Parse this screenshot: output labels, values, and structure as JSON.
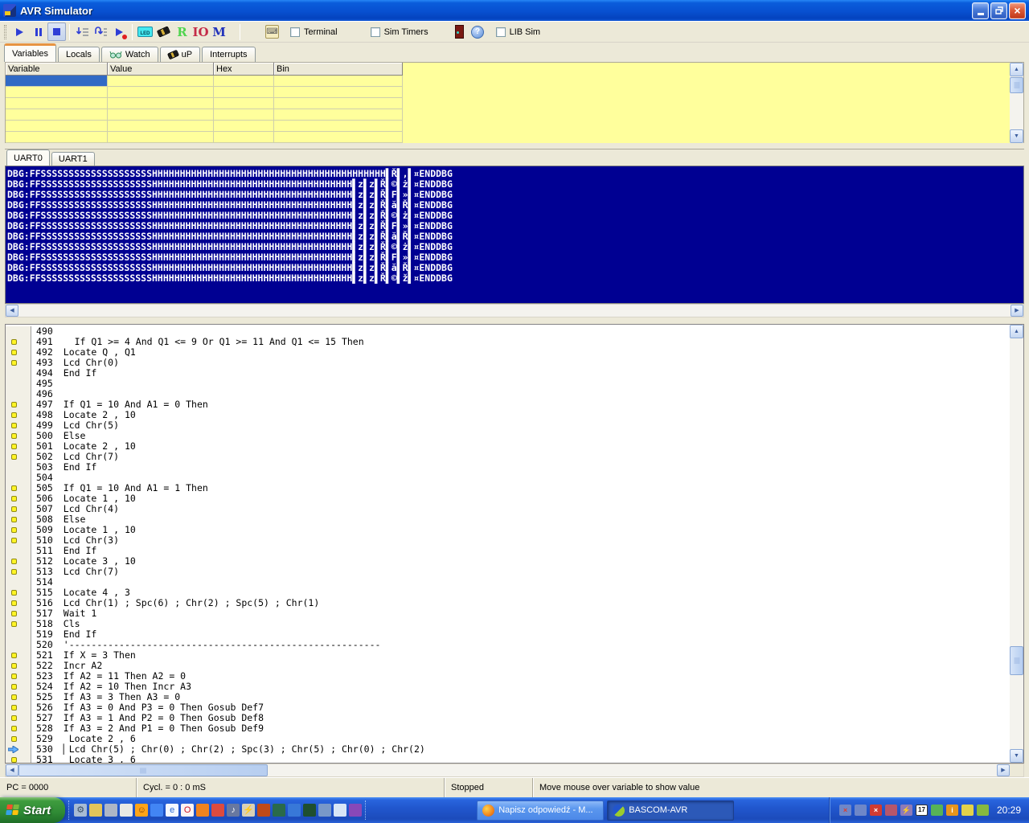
{
  "window": {
    "title": "AVR Simulator"
  },
  "toolbar": {
    "led_label": "LED",
    "r_label": "R",
    "io_label": "IO",
    "m_label": "M",
    "terminal_label": "Terminal",
    "sim_timers_label": "Sim Timers",
    "lib_sim_label": "LIB Sim",
    "accent_blue": "#2E3ED6"
  },
  "tabs": {
    "items": [
      "Variables",
      "Locals",
      "Watch",
      "uP",
      "Interrupts"
    ],
    "active": "Variables"
  },
  "variables_table": {
    "columns": [
      "Variable",
      "Value",
      "Hex",
      "Bin"
    ],
    "row_count": 6,
    "selected_cell": {
      "row": 0,
      "col": 0
    },
    "grid_bg": "#FFFF9C",
    "selection_color": "#316AC5"
  },
  "uart": {
    "tabs": [
      "UART0",
      "UART1"
    ],
    "active": "UART0",
    "terminal_bg": "#000092",
    "lines": [
      "DBG:FFSSSSSSSSSSSSSSSSSSSSHHHHHHHHHHHHHHHHHHHHHHHHHHHHHHHHHHHHHHHHHH▌Ř▌,▌¤ENDDBG",
      "DBG:FFSSSSSSSSSSSSSSSSSSSSHHHHHHHHHHHHHHHHHHHHHHHHHHHHHHHHHHHH▌z▌z▌Ř▌©▌ż▌¤ENDDBG",
      "DBG:FFSSSSSSSSSSSSSSSSSSSSHHHHHHHHHHHHHHHHHHHHHHHHHHHHHHHHHHHH▌z▌z▌Ř▌F▌»▌¤ENDDBG",
      "DBG:FFSSSSSSSSSSSSSSSSSSSSHHHHHHHHHHHHHHHHHHHHHHHHHHHHHHHHHHHH▌z▌z▌Ř▌ă▌Ř▌¤ENDDBG",
      "DBG:FFSSSSSSSSSSSSSSSSSSSSHHHHHHHHHHHHHHHHHHHHHHHHHHHHHHHHHHHH▌z▌z▌Ř▌©▌ż▌¤ENDDBG",
      "DBG:FFSSSSSSSSSSSSSSSSSSSSHHHHHHHHHHHHHHHHHHHHHHHHHHHHHHHHHHHH▌z▌z▌Ř▌F▌»▌¤ENDDBG",
      "DBG:FFSSSSSSSSSSSSSSSSSSSSHHHHHHHHHHHHHHHHHHHHHHHHHHHHHHHHHHHH▌z▌z▌Ř▌ă▌Ř▌¤ENDDBG",
      "DBG:FFSSSSSSSSSSSSSSSSSSSSHHHHHHHHHHHHHHHHHHHHHHHHHHHHHHHHHHHH▌z▌z▌Ř▌©▌ż▌¤ENDDBG",
      "DBG:FFSSSSSSSSSSSSSSSSSSSSHHHHHHHHHHHHHHHHHHHHHHHHHHHHHHHHHHHH▌z▌z▌Ř▌F▌»▌¤ENDDBG",
      "DBG:FFSSSSSSSSSSSSSSSSSSSSHHHHHHHHHHHHHHHHHHHHHHHHHHHHHHHHHHHH▌z▌z▌Ř▌ă▌Ř▌¤ENDDBG",
      "DBG:FFSSSSSSSSSSSSSSSSSSSSHHHHHHHHHHHHHHHHHHHHHHHHHHHHHHHHHHHH▌z▌z▌Ř▌©▌ž▌¤ENDDBG"
    ]
  },
  "code": {
    "breakpoint_color": "#FFF426",
    "lines": [
      {
        "num": "490",
        "marker": "none",
        "text": ""
      },
      {
        "num": "491",
        "marker": "breakpoint",
        "text": "  If Q1 >= 4 And Q1 <= 9 Or Q1 >= 11 And Q1 <= 15 Then"
      },
      {
        "num": "492",
        "marker": "breakpoint",
        "text": "Locate Q , Q1"
      },
      {
        "num": "493",
        "marker": "breakpoint",
        "text": "Lcd Chr(0)"
      },
      {
        "num": "494",
        "marker": "none",
        "text": "End If"
      },
      {
        "num": "495",
        "marker": "none",
        "text": ""
      },
      {
        "num": "496",
        "marker": "none",
        "text": ""
      },
      {
        "num": "497",
        "marker": "breakpoint",
        "text": "If Q1 = 10 And A1 = 0 Then"
      },
      {
        "num": "498",
        "marker": "breakpoint",
        "text": "Locate 2 , 10"
      },
      {
        "num": "499",
        "marker": "breakpoint",
        "text": "Lcd Chr(5)"
      },
      {
        "num": "500",
        "marker": "breakpoint",
        "text": "Else"
      },
      {
        "num": "501",
        "marker": "breakpoint",
        "text": "Locate 2 , 10"
      },
      {
        "num": "502",
        "marker": "breakpoint",
        "text": "Lcd Chr(7)"
      },
      {
        "num": "503",
        "marker": "none",
        "text": "End If"
      },
      {
        "num": "504",
        "marker": "none",
        "text": ""
      },
      {
        "num": "505",
        "marker": "breakpoint",
        "text": "If Q1 = 10 And A1 = 1 Then"
      },
      {
        "num": "506",
        "marker": "breakpoint",
        "text": "Locate 1 , 10"
      },
      {
        "num": "507",
        "marker": "breakpoint",
        "text": "Lcd Chr(4)"
      },
      {
        "num": "508",
        "marker": "breakpoint",
        "text": "Else"
      },
      {
        "num": "509",
        "marker": "breakpoint",
        "text": "Locate 1 , 10"
      },
      {
        "num": "510",
        "marker": "breakpoint",
        "text": "Lcd Chr(3)"
      },
      {
        "num": "511",
        "marker": "none",
        "text": "End If"
      },
      {
        "num": "512",
        "marker": "breakpoint",
        "text": "Locate 3 , 10"
      },
      {
        "num": "513",
        "marker": "breakpoint",
        "text": "Lcd Chr(7)"
      },
      {
        "num": "514",
        "marker": "none",
        "text": ""
      },
      {
        "num": "515",
        "marker": "breakpoint",
        "text": "Locate 4 , 3"
      },
      {
        "num": "516",
        "marker": "breakpoint",
        "text": "Lcd Chr(1) ; Spc(6) ; Chr(2) ; Spc(5) ; Chr(1)"
      },
      {
        "num": "517",
        "marker": "breakpoint",
        "text": "Wait 1"
      },
      {
        "num": "518",
        "marker": "breakpoint",
        "text": "Cls"
      },
      {
        "num": "519",
        "marker": "none",
        "text": "End If"
      },
      {
        "num": "520",
        "marker": "none",
        "text": "'--------------------------------------------------------"
      },
      {
        "num": "521",
        "marker": "breakpoint",
        "text": "If X = 3 Then"
      },
      {
        "num": "522",
        "marker": "breakpoint",
        "text": "Incr A2"
      },
      {
        "num": "523",
        "marker": "breakpoint",
        "text": "If A2 = 11 Then A2 = 0"
      },
      {
        "num": "524",
        "marker": "breakpoint",
        "text": "If A2 = 10 Then Incr A3"
      },
      {
        "num": "525",
        "marker": "breakpoint",
        "text": "If A3 = 3 Then A3 = 0"
      },
      {
        "num": "526",
        "marker": "breakpoint",
        "text": "If A3 = 0 And P3 = 0 Then Gosub Def7"
      },
      {
        "num": "527",
        "marker": "breakpoint",
        "text": "If A3 = 1 And P2 = 0 Then Gosub Def8"
      },
      {
        "num": "528",
        "marker": "breakpoint",
        "text": "If A3 = 2 And P1 = 0 Then Gosub Def9"
      },
      {
        "num": "529",
        "marker": "breakpoint",
        "text": " Locate 2 , 6"
      },
      {
        "num": "530",
        "marker": "current",
        "text": "▏Lcd Chr(5) ; Chr(0) ; Chr(2) ; Spc(3) ; Chr(5) ; Chr(0) ; Chr(2)"
      },
      {
        "num": "531",
        "marker": "breakpoint",
        "text": " Locate 3 , 6"
      }
    ]
  },
  "statusbar": {
    "pc": "PC = 0000",
    "cycles": "Cycl. = 0 : 0 mS",
    "state": "Stopped",
    "hint": "Move mouse over variable to show value"
  },
  "taskbar": {
    "start_label": "Start",
    "clock": "20:29",
    "tasks": [
      {
        "label": "Napisz odpowiedź - M...",
        "icon": "firefox-task-icon",
        "active": false
      },
      {
        "label": "BASCOM-AVR",
        "icon": "bascom-task-icon",
        "active": true
      }
    ],
    "quicklaunch": [
      {
        "name": "quicklaunch-gear-icon",
        "glyph": "⚙",
        "bg": "#A8BBD4",
        "fg": "#3A4E66"
      },
      {
        "name": "quicklaunch-tool-icon",
        "glyph": "",
        "bg": "#E3C45A",
        "fg": "#6B4F17"
      },
      {
        "name": "quicklaunch-server-icon",
        "glyph": "",
        "bg": "#AEB6C6",
        "fg": "#333"
      },
      {
        "name": "quicklaunch-watch-icon",
        "glyph": "",
        "bg": "#E9E9E4",
        "fg": "#444"
      },
      {
        "name": "quicklaunch-smiley-icon",
        "glyph": "☺",
        "bg": "#FFA418",
        "fg": "#7A3A00"
      },
      {
        "name": "quicklaunch-photo-icon",
        "glyph": "",
        "bg": "#4285F4",
        "fg": "#fff"
      },
      {
        "name": "quicklaunch-ie-icon",
        "glyph": "e",
        "bg": "#F4F8FF",
        "fg": "#2A6AD4"
      },
      {
        "name": "quicklaunch-opera-icon",
        "glyph": "O",
        "bg": "#FBF3F3",
        "fg": "#CC1122"
      },
      {
        "name": "quicklaunch-firefox-icon",
        "glyph": "",
        "bg": "#F0831E",
        "fg": "#fff"
      },
      {
        "name": "quicklaunch-chrome-icon",
        "glyph": "",
        "bg": "#DD4B3E",
        "fg": "#fff"
      },
      {
        "name": "quicklaunch-music-icon",
        "glyph": "♪",
        "bg": "#6878A0",
        "fg": "#fff"
      },
      {
        "name": "quicklaunch-lightning-icon",
        "glyph": "⚡",
        "bg": "#D9D0B6",
        "fg": "#B78A00"
      },
      {
        "name": "quicklaunch-bell-icon",
        "glyph": "",
        "bg": "#C04A18",
        "fg": "#fff"
      },
      {
        "name": "quicklaunch-tv-icon",
        "glyph": "",
        "bg": "#2A6A4A",
        "fg": "#fff"
      },
      {
        "name": "quicklaunch-globe-icon",
        "glyph": "",
        "bg": "#3878D8",
        "fg": "#fff"
      },
      {
        "name": "quicklaunch-eye-icon",
        "glyph": "",
        "bg": "#1F4F2F",
        "fg": "#fff"
      },
      {
        "name": "quicklaunch-monitor-icon",
        "glyph": "",
        "bg": "#7898C8",
        "fg": "#fff"
      },
      {
        "name": "quicklaunch-feather-icon",
        "glyph": "",
        "bg": "#D8E6F6",
        "fg": "#345"
      },
      {
        "name": "quicklaunch-ball-icon",
        "glyph": "",
        "bg": "#8848B8",
        "fg": "#fff"
      }
    ],
    "tray": [
      {
        "name": "tray-network-offline-icon",
        "glyph": "×",
        "bg": "#6E87C8",
        "fg": "#E03A2A"
      },
      {
        "name": "tray-network-icon",
        "glyph": "",
        "bg": "#6E87C8",
        "fg": "#fff"
      },
      {
        "name": "tray-security-alert-icon",
        "glyph": "×",
        "bg": "#D13B30",
        "fg": "#fff"
      },
      {
        "name": "tray-app-icon",
        "glyph": "",
        "bg": "#B5566B",
        "fg": "#fff"
      },
      {
        "name": "tray-power-icon",
        "glyph": "⚡",
        "bg": "#8D7BB8",
        "fg": "#FFE066"
      },
      {
        "name": "tray-calendar-icon",
        "glyph": "17",
        "bg": "#FFFFFF",
        "fg": "#111"
      },
      {
        "name": "tray-usb-icon",
        "glyph": "",
        "bg": "#57B357",
        "fg": "#fff"
      },
      {
        "name": "tray-info-icon",
        "glyph": "i",
        "bg": "#E8951D",
        "fg": "#fff"
      },
      {
        "name": "tray-notes-icon",
        "glyph": "",
        "bg": "#E3D24A",
        "fg": "#665"
      },
      {
        "name": "tray-nvidia-icon",
        "glyph": "",
        "bg": "#86B93F",
        "fg": "#fff"
      }
    ]
  }
}
